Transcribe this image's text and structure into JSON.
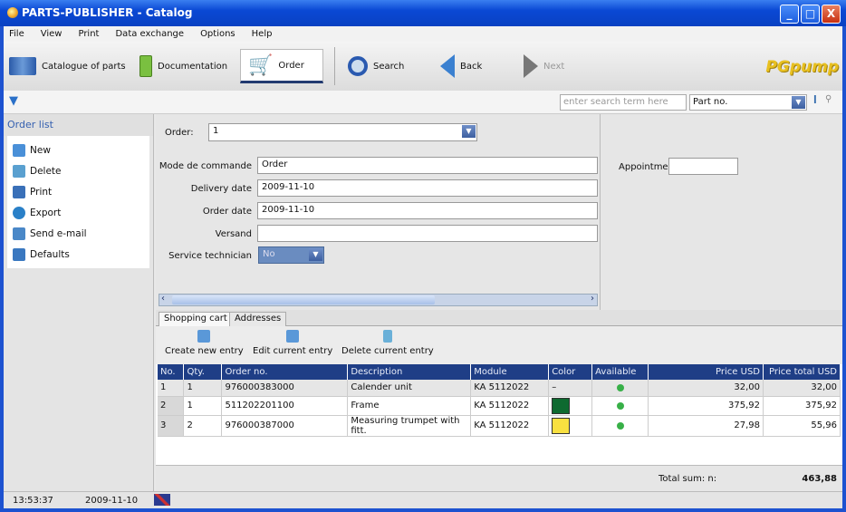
{
  "window": {
    "title": "PARTS-PUBLISHER - Catalog",
    "controls": [
      "_",
      "□",
      "X"
    ]
  },
  "menu": [
    "File",
    "View",
    "Print",
    "Data exchange",
    "Options",
    "Help"
  ],
  "toolbar": {
    "catalogue": "Catalogue of parts",
    "documentation": "Documentation",
    "order": "Order",
    "search": "Search",
    "back": "Back",
    "next": "Next",
    "brand": "PGpump"
  },
  "search": {
    "placeholder": "enter search term here",
    "field": "Part no."
  },
  "order_list": {
    "title": "Order list",
    "items": [
      {
        "label": "New",
        "color": "#4a90d8"
      },
      {
        "label": "Delete",
        "color": "#5aa0d0"
      },
      {
        "label": "Print",
        "color": "#3a70b8"
      },
      {
        "label": "Export",
        "color": "#2a80c8"
      },
      {
        "label": "Send e-mail",
        "color": "#4a88c8"
      },
      {
        "label": "Defaults",
        "color": "#3a78c0"
      }
    ]
  },
  "form": {
    "order_label": "Order:",
    "order_value": "1",
    "mode_label": "Mode de commande",
    "mode_value": "Order",
    "delivery_label": "Delivery date",
    "delivery_value": "2009-11-10",
    "orderdate_label": "Order date",
    "orderdate_value": "2009-11-10",
    "versand_label": "Versand",
    "versand_value": "",
    "tech_label": "Service technician",
    "tech_value": "No",
    "appointment_label": "Appointment",
    "appointment_value": ""
  },
  "tabs": [
    "Shopping cart",
    "Addresses"
  ],
  "cart_actions": [
    "Create new entry",
    "Edit current entry",
    "Delete current entry"
  ],
  "table": {
    "headers": [
      "No.",
      "Qty.",
      "Order no.",
      "Description",
      "Module",
      "Color",
      "Available",
      "Price USD",
      "Price total USD"
    ],
    "rows": [
      {
        "no": "1",
        "qty": "1",
        "order_no": "976000383000",
        "description": "Calender unit",
        "module": "KA 5112022",
        "color": "–",
        "swatch": "",
        "price": "32,00",
        "total": "32,00"
      },
      {
        "no": "2",
        "qty": "1",
        "order_no": "511202201100",
        "description": "Frame",
        "module": "KA 5112022",
        "color": "",
        "swatch": "#0e6a30",
        "price": "375,92",
        "total": "375,92"
      },
      {
        "no": "3",
        "qty": "2",
        "order_no": "976000387000",
        "description": "Measuring trumpet with fitt.",
        "module": "KA 5112022",
        "color": "",
        "swatch": "#f8e040",
        "price": "27,98",
        "total": "55,96"
      }
    ]
  },
  "totals": {
    "label": "Total sum:  n:",
    "value": "463,88"
  },
  "status": {
    "time": "13:53:37",
    "date": "2009-11-10"
  }
}
